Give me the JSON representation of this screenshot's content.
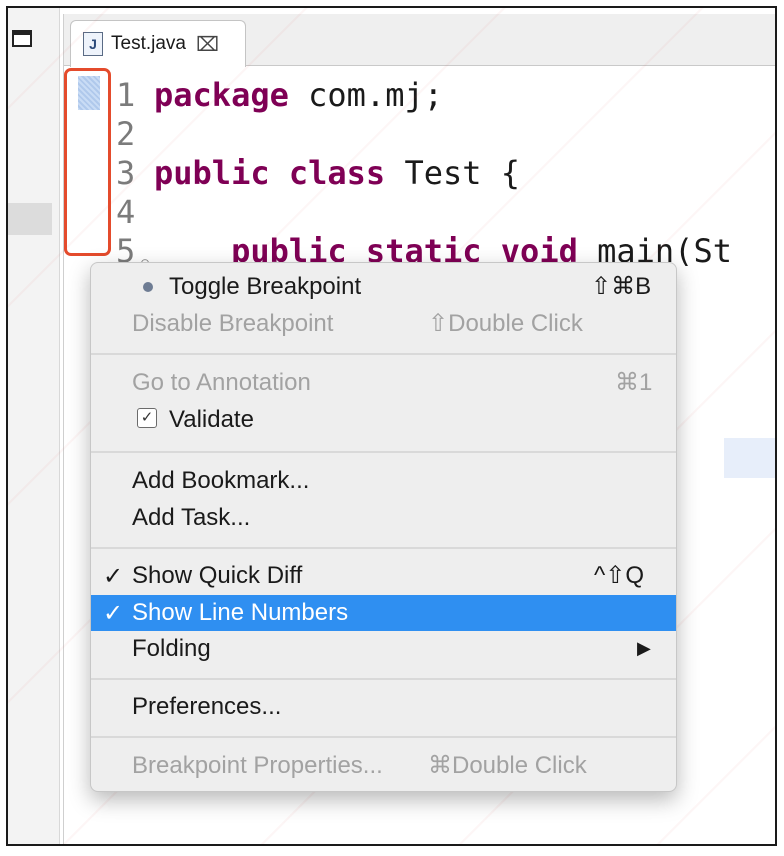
{
  "editor": {
    "tab_title": "Test.java",
    "tab_icon": "J",
    "close_glyph": "⌧"
  },
  "code": {
    "lines": [
      {
        "num": "1",
        "kw": "package",
        "text": " com.mj;"
      },
      {
        "num": "2",
        "kw": "",
        "text": ""
      },
      {
        "num": "3",
        "kw": "public class",
        "text": " Test {"
      },
      {
        "num": "4",
        "kw": "",
        "text": ""
      },
      {
        "num": "5",
        "kw": "    public static void",
        "text": " main(St"
      }
    ]
  },
  "menu": {
    "toggle_breakpoint": {
      "label": "Toggle Breakpoint",
      "shortcut": "⇧⌘B"
    },
    "disable_breakpoint": {
      "label": "Disable Breakpoint",
      "shortcut": "⇧Double Click"
    },
    "go_to_annotation": {
      "label": "Go to Annotation",
      "shortcut": "⌘1"
    },
    "validate": {
      "label": "Validate",
      "check": "✓"
    },
    "add_bookmark": {
      "label": "Add Bookmark..."
    },
    "add_task": {
      "label": "Add Task..."
    },
    "show_quick_diff": {
      "label": "Show Quick Diff",
      "shortcut": "^⇧Q",
      "check": "✓"
    },
    "show_line_numbers": {
      "label": "Show Line Numbers",
      "check": "✓"
    },
    "folding": {
      "label": "Folding",
      "arrow": "▶"
    },
    "preferences": {
      "label": "Preferences..."
    },
    "breakpoint_properties": {
      "label": "Breakpoint Properties...",
      "shortcut": "⌘Double Click"
    }
  },
  "colors": {
    "keyword": "#7f0055",
    "selection": "#2f8ff1",
    "annotation_box": "#e44b2c"
  }
}
